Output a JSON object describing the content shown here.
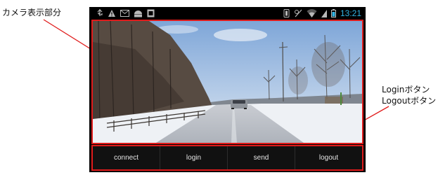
{
  "annotations": {
    "camera_label": "カメラ表示部分",
    "button_label_line1": "Loginボタン",
    "button_label_line2": "Logoutボタン"
  },
  "statusbar": {
    "time": "13:21",
    "left_icons": [
      "usb-icon",
      "warning-icon",
      "mail-icon",
      "android-icon",
      "image-icon"
    ],
    "right_icons": [
      "vibrate-icon",
      "no-signal-icon",
      "wifi-icon",
      "battery-icon"
    ]
  },
  "camera": {
    "description_colors": {
      "sky": "#8fb3dd",
      "snow": "#eef1f5",
      "road": "#c9ccd2"
    }
  },
  "buttons": [
    {
      "label": "connect"
    },
    {
      "label": "login"
    },
    {
      "label": "send"
    },
    {
      "label": "logout"
    }
  ],
  "colors": {
    "highlight": "#e01b1b",
    "clock": "#33b5e5"
  }
}
